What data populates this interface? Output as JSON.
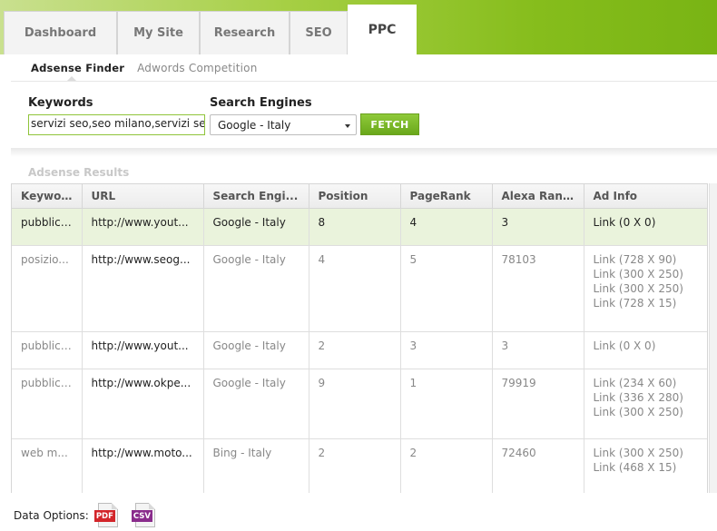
{
  "tabs": [
    {
      "label": "Dashboard"
    },
    {
      "label": "My Site"
    },
    {
      "label": "Research"
    },
    {
      "label": "SEO"
    },
    {
      "label": "PPC",
      "active": true
    }
  ],
  "subtabs": [
    {
      "label": "Adsense Finder",
      "active": true
    },
    {
      "label": "Adwords Competition"
    }
  ],
  "form": {
    "keywords_label": "Keywords",
    "keywords_value": "servizi seo,seo milano,servizi seo",
    "engines_label": "Search Engines",
    "engine_value": "Google - Italy",
    "fetch_label": "FETCH"
  },
  "results": {
    "title": "Adsense Results",
    "columns": [
      "Keywo...",
      "URL",
      "Search Engi...",
      "Position",
      "PageRank",
      "Alexa Ran...",
      "Ad Info"
    ],
    "rows": [
      {
        "keyword": "pubblici...",
        "url": "http://www.yout...",
        "engine": "Google - Italy",
        "position": "8",
        "pagerank": "4",
        "alexa": "3",
        "ads": [
          "Link (0 X 0)"
        ],
        "selected": true
      },
      {
        "keyword": "posizio...",
        "url": "http://www.seog...",
        "engine": "Google - Italy",
        "position": "4",
        "pagerank": "5",
        "alexa": "78103",
        "ads": [
          "Link (728 X 90)",
          "Link (300 X 250)",
          "Link (300 X 250)",
          "Link (728 X 15)"
        ]
      },
      {
        "keyword": "pubblici...",
        "url": "http://www.yout...",
        "engine": "Google - Italy",
        "position": "2",
        "pagerank": "3",
        "alexa": "3",
        "ads": [
          "Link (0 X 0)"
        ]
      },
      {
        "keyword": "pubblici...",
        "url": "http://www.okpe...",
        "engine": "Google - Italy",
        "position": "9",
        "pagerank": "1",
        "alexa": "79919",
        "ads": [
          "Link (234 X 60)",
          "Link (336 X 280)",
          "Link (300 X 250)"
        ]
      },
      {
        "keyword": "web m...",
        "url": "http://www.moto...",
        "engine": "Bing - Italy",
        "position": "2",
        "pagerank": "2",
        "alexa": "72460",
        "ads": [
          "Link (300 X 250)",
          "Link (468 X 15)"
        ]
      }
    ]
  },
  "data_options": {
    "label": "Data Options:",
    "pdf": "PDF",
    "csv": "CSV"
  }
}
